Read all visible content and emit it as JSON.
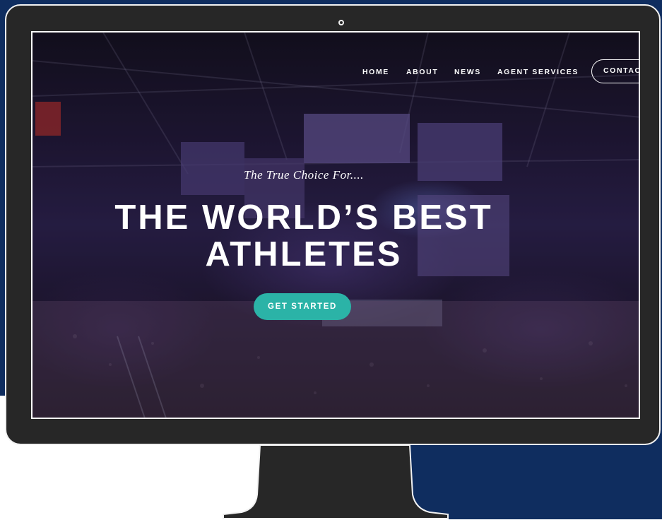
{
  "nav": {
    "home": "HOME",
    "about": "ABOUT",
    "news": "NEWS",
    "agent_services": "AGENT SERVICES",
    "contact": "CONTACT"
  },
  "hero": {
    "tagline": "The True Choice For....",
    "headline_line1": "THE WORLD’S BEST",
    "headline_line2": "ATHLETES",
    "cta": "GET STARTED"
  },
  "colors": {
    "navy_background": "#0f2d5f",
    "monitor_bezel": "#272727",
    "cta_teal": "#2bb3a7"
  },
  "icons": [
    "camera-dot-icon"
  ]
}
